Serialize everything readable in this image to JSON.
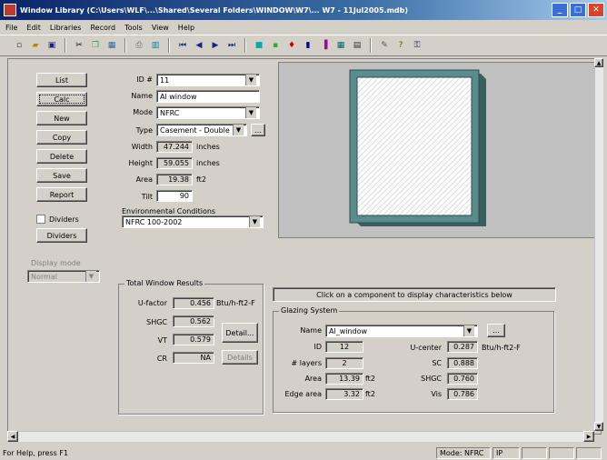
{
  "window": {
    "title": "Window Library (C:\\Users\\WLF\\...\\Shared\\Several Folders\\WINDOW\\W7\\... W7 - 11Jul2005.mdb)",
    "minimize": "_",
    "maximize": "□",
    "close": "✕"
  },
  "menu": [
    "File",
    "Edit",
    "Libraries",
    "Record",
    "Tools",
    "View",
    "Help"
  ],
  "toolbar_icons": [
    "new-icon",
    "open-icon",
    "save-icon",
    "cut-icon",
    "copy-icon",
    "paste-icon",
    "print-icon",
    "calc-icon",
    "first-icon",
    "prev-icon",
    "next-icon",
    "last-icon",
    "layer1-icon",
    "layer2-icon",
    "red-icon",
    "blue-icon",
    "chart-icon",
    "grid-icon",
    "info-icon",
    "help-icon"
  ],
  "sidebar": {
    "buttons": [
      "List",
      "Calc",
      "New",
      "Copy",
      "Delete",
      "Save",
      "Report"
    ],
    "dividers_label": "Dividers",
    "dividers_button": "Dividers",
    "display_mode_label": "Display mode",
    "display_mode_value": "Normal"
  },
  "form": {
    "id_label": "ID #",
    "id_value": "11",
    "name_label": "Name",
    "name_value": "Al window",
    "mode_label": "Mode",
    "mode_value": "NFRC",
    "type_label": "Type",
    "type_value": "Casement - Double",
    "width_label": "Width",
    "width_value": "47.244",
    "width_unit": "inches",
    "height_label": "Height",
    "height_value": "59.055",
    "height_unit": "inches",
    "area_label": "Area",
    "area_value": "19.38",
    "area_unit": "ft2",
    "tilt_label": "Tilt",
    "tilt_value": "90",
    "env_label": "Environmental Conditions",
    "env_value": "NFRC 100-2002"
  },
  "results": {
    "title": "Total Window Results",
    "ufactor_label": "U-factor",
    "ufactor_value": "0.456",
    "ufactor_unit": "Btu/h-ft2-F",
    "shgc_label": "SHGC",
    "shgc_value": "0.562",
    "vt_label": "VT",
    "vt_value": "0.579",
    "cr_label": "CR",
    "cr_value": "NA",
    "detail_button": "Detail...",
    "details_button": "Details"
  },
  "glazing": {
    "hint": "Click on a component to display characteristics below",
    "title": "Glazing System",
    "name_label": "Name",
    "name_value": "Al_window",
    "id_label": "ID",
    "id_value": "12",
    "layers_label": "# layers",
    "layers_value": "2",
    "area_label": "Area",
    "area_value": "13.39",
    "area_unit": "ft2",
    "edge_label": "Edge area",
    "edge_value": "3.32",
    "edge_unit": "ft2",
    "ufactor_label": "U-center",
    "ufactor_value": "0.287",
    "ufactor_unit": "Btu/h-ft2-F",
    "sc_label": "SC",
    "sc_value": "0.888",
    "shgc_label": "SHGC",
    "shgc_value": "0.760",
    "vis_label": "Vis",
    "vis_value": "0.786"
  },
  "status": {
    "help_text": "For Help, press F1",
    "mode": "Mode: NFRC",
    "units": "IP"
  }
}
